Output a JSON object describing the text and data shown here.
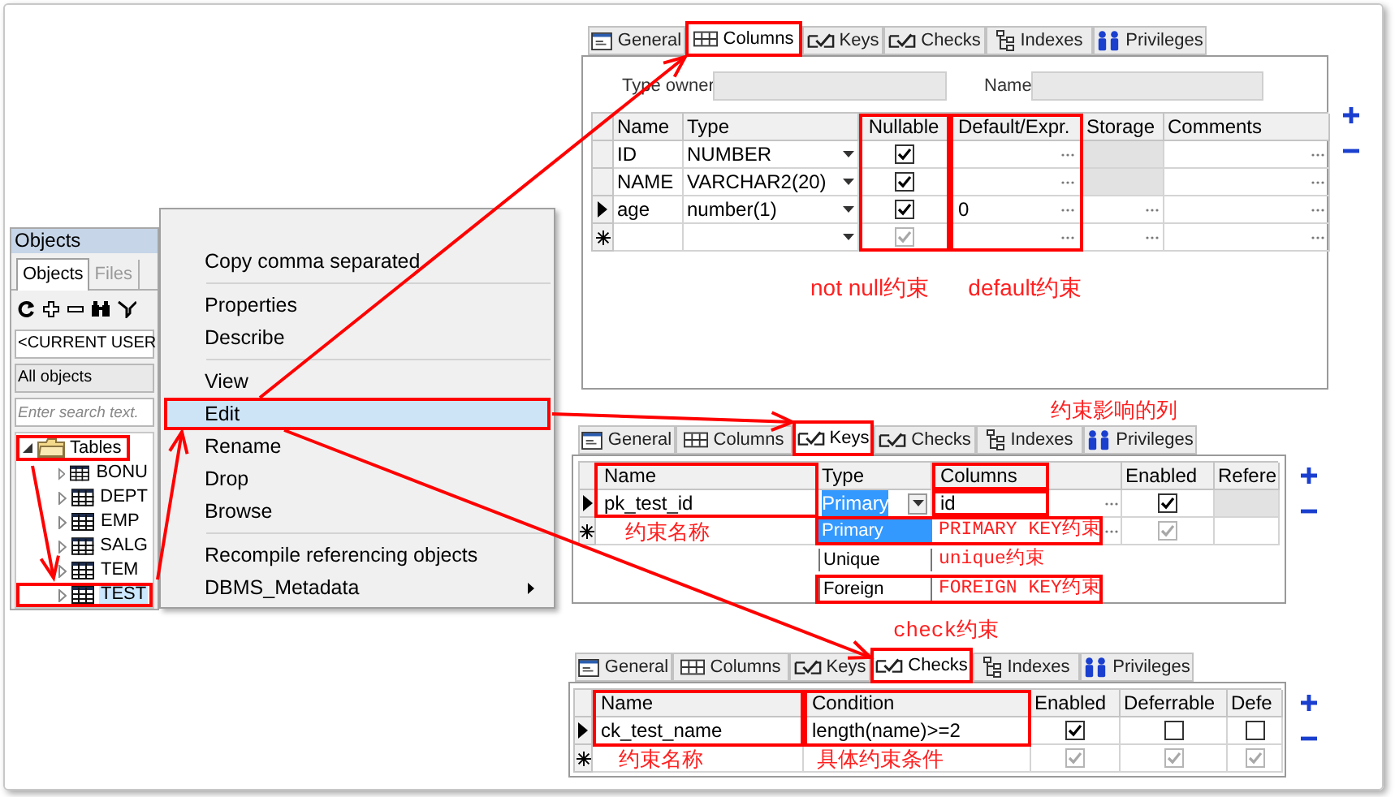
{
  "objects_panel": {
    "title": "Objects",
    "tabs": [
      {
        "label": "Objects",
        "selected": true
      },
      {
        "label": "Files",
        "selected": false
      }
    ],
    "owner_filter": "<CURRENT USER",
    "type_filter": "All objects",
    "search": {
      "placeholder": "Enter search text."
    },
    "tree": [
      {
        "label": "Tables",
        "expanded": true,
        "children": [
          {
            "label": "BONU",
            "selected": false
          },
          {
            "label": "DEPT",
            "selected": false
          },
          {
            "label": "EMP",
            "selected": false
          },
          {
            "label": "SALG",
            "selected": false
          },
          {
            "label": "TEM",
            "selected": false
          },
          {
            "label": "TEST",
            "selected": true
          }
        ]
      }
    ]
  },
  "context_menu": {
    "groups": [
      {
        "items": [
          {
            "label": "Copy comma separated",
            "selected": false,
            "submenu": false
          }
        ]
      },
      {
        "items": [
          {
            "label": "Properties",
            "selected": false,
            "submenu": false
          },
          {
            "label": "Describe",
            "selected": false,
            "submenu": false
          }
        ]
      },
      {
        "items": [
          {
            "label": "View",
            "selected": false,
            "submenu": false
          },
          {
            "label": "Edit",
            "selected": true,
            "submenu": false
          },
          {
            "label": "Rename",
            "selected": false,
            "submenu": false
          },
          {
            "label": "Drop",
            "selected": false,
            "submenu": false
          },
          {
            "label": "Browse",
            "selected": false,
            "submenu": false
          }
        ]
      },
      {
        "items": [
          {
            "label": "Recompile referencing objects",
            "selected": false,
            "submenu": false
          },
          {
            "label": "DBMS_Metadata",
            "selected": false,
            "submenu": true
          }
        ]
      }
    ]
  },
  "columns_editor": {
    "tabs": [
      {
        "label": "General",
        "selected": false
      },
      {
        "label": "Columns",
        "selected": true
      },
      {
        "label": "Keys",
        "selected": false
      },
      {
        "label": "Checks",
        "selected": false
      },
      {
        "label": "Indexes",
        "selected": false
      },
      {
        "label": "Privileges",
        "selected": false
      }
    ],
    "type_owner_label": "Type owner",
    "name_label": "Name",
    "columns": [
      "Name",
      "Type",
      "Nullable",
      "Default/Expr.",
      "Storage",
      "Comments"
    ],
    "rows": [
      {
        "kind": "row",
        "name": "ID",
        "type": "NUMBER",
        "nullable": true,
        "current": false,
        "storage_disabled": true
      },
      {
        "kind": "row",
        "name": "NAME",
        "type": "VARCHAR2(20)",
        "nullable": true,
        "current": false,
        "storage_disabled": true
      },
      {
        "kind": "row",
        "name": "age",
        "type": "number(1)",
        "nullable": true,
        "default": "0",
        "current": true,
        "storage_disabled": false
      },
      {
        "kind": "new",
        "nullable": true
      }
    ],
    "annotations": [
      "not null约束",
      "default约束"
    ]
  },
  "keys_editor": {
    "tabs": [
      {
        "label": "General",
        "selected": false
      },
      {
        "label": "Columns",
        "selected": false
      },
      {
        "label": "Keys",
        "selected": true
      },
      {
        "label": "Checks",
        "selected": false
      },
      {
        "label": "Indexes",
        "selected": false
      },
      {
        "label": "Privileges",
        "selected": false
      }
    ],
    "columns": [
      "Name",
      "Type",
      "Columns",
      "Enabled",
      "Refere"
    ],
    "rows": [
      {
        "kind": "row",
        "name": "pk_test_id",
        "type": "Primary",
        "columns": "id",
        "enabled": true,
        "current": true
      },
      {
        "kind": "new",
        "enabled": true
      }
    ],
    "type_dropdown": [
      {
        "label": "Primary",
        "selected": true
      },
      {
        "label": "Unique",
        "selected": false
      },
      {
        "label": "Foreign",
        "selected": false
      }
    ],
    "type_notes": [
      "PRIMARY KEY约束",
      "unique约束",
      "FOREIGN KEY约束"
    ],
    "annotations": [
      "约束影响的列",
      "约束名称"
    ]
  },
  "checks_editor": {
    "tabs": [
      {
        "label": "General",
        "selected": false
      },
      {
        "label": "Columns",
        "selected": false
      },
      {
        "label": "Keys",
        "selected": false
      },
      {
        "label": "Checks",
        "selected": true
      },
      {
        "label": "Indexes",
        "selected": false
      },
      {
        "label": "Privileges",
        "selected": false
      }
    ],
    "columns": [
      "Name",
      "Condition",
      "Enabled",
      "Deferrable",
      "Defe"
    ],
    "rows": [
      {
        "kind": "row",
        "name": "ck_test_name",
        "condition": "length(name)>=2",
        "enabled": true,
        "deferrable": false,
        "deferred": false,
        "current": true
      },
      {
        "kind": "new",
        "enabled": true,
        "deferrable": true,
        "deferred": true
      }
    ],
    "annotations": [
      "check约束",
      "约束名称",
      "具体约束条件"
    ]
  }
}
